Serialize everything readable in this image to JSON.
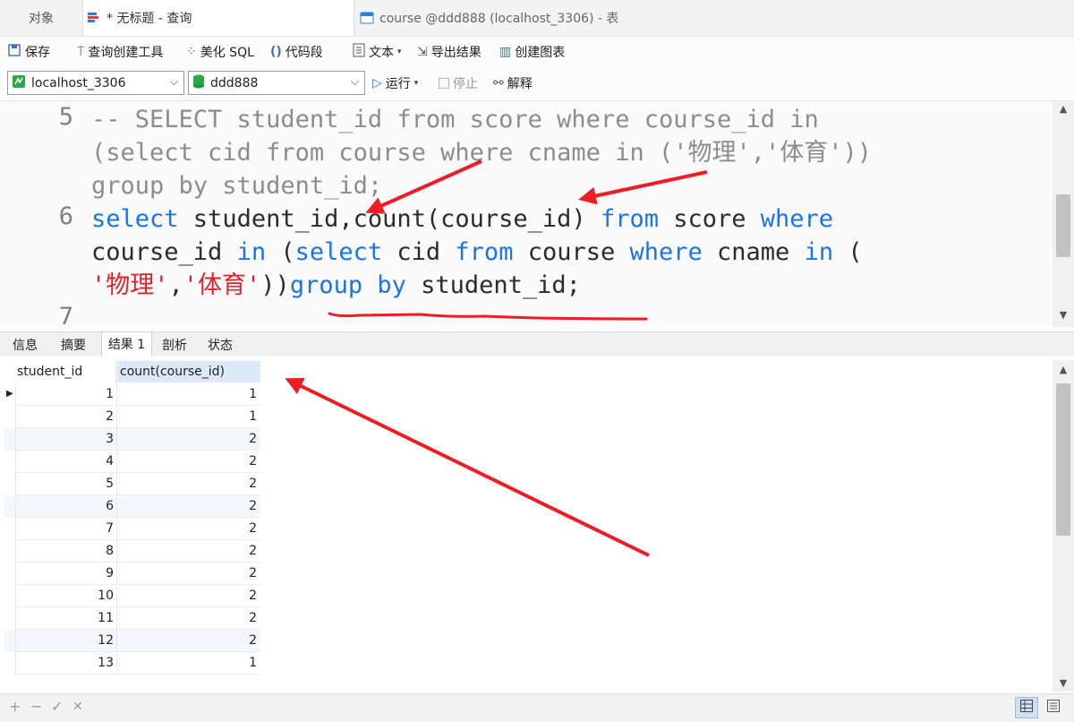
{
  "tabs": {
    "objects": "对象",
    "query": "* 无标题 - 查询",
    "table": "course @ddd888 (localhost_3306) - 表"
  },
  "toolbar": {
    "save": "保存",
    "query_builder": "查询创建工具",
    "beautify": "美化 SQL",
    "snippet": "代码段",
    "text": "文本",
    "export": "导出结果",
    "create_chart": "创建图表"
  },
  "connection": {
    "server": "localhost_3306",
    "database": "ddd888",
    "run": "运行",
    "stop": "停止",
    "explain": "解释"
  },
  "editor": {
    "line5_no": "5",
    "line5_a": "-- SELECT student_id from score where course_id in",
    "line5_b": "(select cid from course where cname in ('物理','体育'))",
    "line5_c": "group by student_id;",
    "line6_no": "6",
    "line6": {
      "kw_select": "select",
      "t1": " student_id,count(course_id) ",
      "kw_from": "from",
      "t2": " score ",
      "kw_where": "where",
      "t3": "course_id ",
      "kw_in": "in",
      "t4": " (",
      "kw_select2": "select",
      "t5": " cid ",
      "kw_from2": "from",
      "t6": " course ",
      "kw_where2": "where",
      "t7": " cname ",
      "kw_in2": "in",
      "t8": " (",
      "s1": "'物理'",
      "t9": ",",
      "s2": "'体育'",
      "t10": "))",
      "kw_group": "group",
      "t11": " ",
      "kw_by": "by",
      "t12": " student_id;"
    },
    "line7_no": "7"
  },
  "result_tabs": [
    "信息",
    "摘要",
    "结果 1",
    "剖析",
    "状态"
  ],
  "result_active": "结果 1",
  "grid": {
    "columns": [
      "student_id",
      "count(course_id)"
    ],
    "rows": [
      [
        "1",
        "1"
      ],
      [
        "2",
        "1"
      ],
      [
        "3",
        "2"
      ],
      [
        "4",
        "2"
      ],
      [
        "5",
        "2"
      ],
      [
        "6",
        "2"
      ],
      [
        "7",
        "2"
      ],
      [
        "8",
        "2"
      ],
      [
        "9",
        "2"
      ],
      [
        "10",
        "2"
      ],
      [
        "11",
        "2"
      ],
      [
        "12",
        "2"
      ],
      [
        "13",
        "1"
      ]
    ]
  },
  "statusbar": {
    "add": "+",
    "remove": "−",
    "apply": "✓",
    "discard": "✕"
  },
  "colors": {
    "keyword": "#1a73e8",
    "string": "#e0202a",
    "comment": "#8c8c8c",
    "annotation": "#ee1c25"
  }
}
